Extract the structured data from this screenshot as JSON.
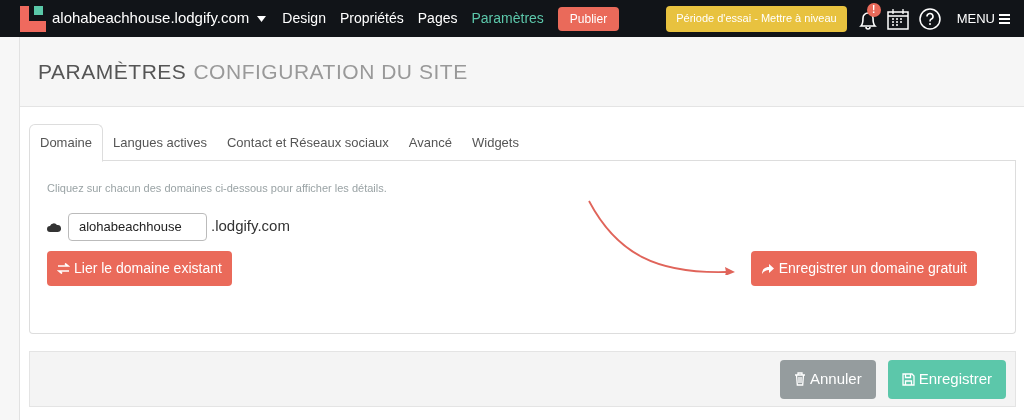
{
  "topbar": {
    "site": "alohabeachhouse.lodgify.com",
    "nav": [
      {
        "label": "Design",
        "selected": false
      },
      {
        "label": "Propriétés",
        "selected": false
      },
      {
        "label": "Pages",
        "selected": false
      },
      {
        "label": "Paramètres",
        "selected": true
      }
    ],
    "publish": "Publier",
    "trial": "Période d'essai - Mettre à niveau",
    "alert_badge": "!",
    "menu": "MENU"
  },
  "heading": {
    "section": "PARAMÈTRES",
    "page": "CONFIGURATION DU SITE"
  },
  "tabs": [
    {
      "label": "Domaine",
      "selected": true
    },
    {
      "label": "Langues actives",
      "selected": false
    },
    {
      "label": "Contact et Réseaux sociaux",
      "selected": false
    },
    {
      "label": "Avancé",
      "selected": false
    },
    {
      "label": "Widgets",
      "selected": false
    }
  ],
  "hint": "Cliquez sur chacun des domaines ci-dessous pour afficher les détails.",
  "domain": {
    "value": "alohabeachhouse",
    "suffix": ".lodgify.com"
  },
  "link_button": "Lier le domaine existant",
  "register_button": "Enregistrer un domaine gratuit",
  "footer": {
    "cancel": "Annuler",
    "save": "Enregistrer"
  }
}
